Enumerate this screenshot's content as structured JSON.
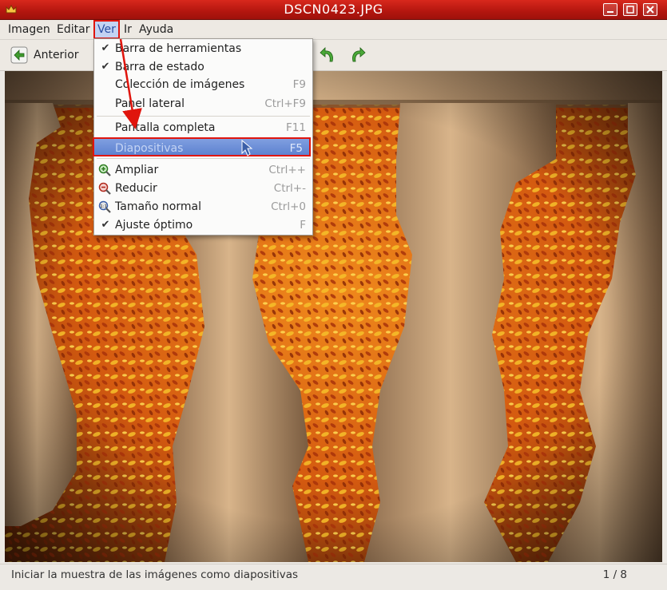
{
  "window": {
    "title": "DSCN0423.JPG",
    "app_icon": "crown-icon",
    "controls": [
      "minimize",
      "maximize",
      "close"
    ]
  },
  "menubar": {
    "items": [
      {
        "label": "Imagen"
      },
      {
        "label": "Editar"
      },
      {
        "label": "Ver",
        "active": true
      },
      {
        "label": "Ir"
      },
      {
        "label": "Ayuda"
      }
    ]
  },
  "toolbar": {
    "previous_label": "Anterior",
    "rotate_left_icon": "rotate-left-icon",
    "rotate_right_icon": "rotate-right-icon"
  },
  "view_menu": {
    "items": [
      {
        "label": "Barra de herramientas",
        "checked": true,
        "accel": ""
      },
      {
        "label": "Barra de estado",
        "checked": true,
        "accel": ""
      },
      {
        "label": "Colección de imágenes",
        "checked": false,
        "accel": "F9"
      },
      {
        "label": "Panel lateral",
        "checked": false,
        "accel": "Ctrl+F9"
      },
      {
        "label": "Pantalla completa",
        "checked": false,
        "accel": "F11"
      },
      {
        "label": "Diapositivas",
        "checked": false,
        "accel": "F5",
        "highlighted": true
      },
      {
        "label": "Ampliar",
        "icon": "zoom-in-icon",
        "accel": "Ctrl++"
      },
      {
        "label": "Reducir",
        "icon": "zoom-out-icon",
        "accel": "Ctrl+-"
      },
      {
        "label": "Tamaño normal",
        "icon": "zoom-original-icon",
        "accel": "Ctrl+0"
      },
      {
        "label": "Ajuste óptimo",
        "checked": true,
        "accel": "F"
      }
    ]
  },
  "statusbar": {
    "message": "Iniciar la muestra de las imágenes como diapositivas",
    "counter": "1 / 8"
  },
  "colors": {
    "titlebar": "#c41e14",
    "highlight": "#6b8dd6",
    "annotation": "#e0150d"
  }
}
